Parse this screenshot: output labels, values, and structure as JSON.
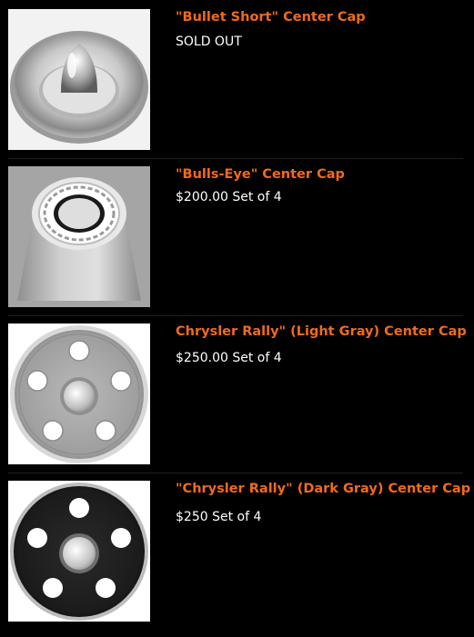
{
  "products": [
    {
      "title": "\"Bullet Short\" Center Cap",
      "price": "SOLD OUT",
      "image_icon": "bullet-center-cap-icon"
    },
    {
      "title": "\"Bulls-Eye\" Center Cap",
      "price": "$200.00 Set of 4",
      "image_icon": "bullseye-center-cap-icon"
    },
    {
      "title": "Chrysler Rally\" (Light Gray) Center Cap",
      "price": "$250.00 Set of 4",
      "image_icon": "rally-light-gray-cap-icon"
    },
    {
      "title": "\"Chrysler Rally\" (Dark Gray) Center Cap",
      "price": "$250 Set of 4",
      "image_icon": "rally-dark-gray-cap-icon"
    }
  ],
  "colors": {
    "background": "#000000",
    "title": "#f26a1b",
    "price": "#ffffff"
  }
}
